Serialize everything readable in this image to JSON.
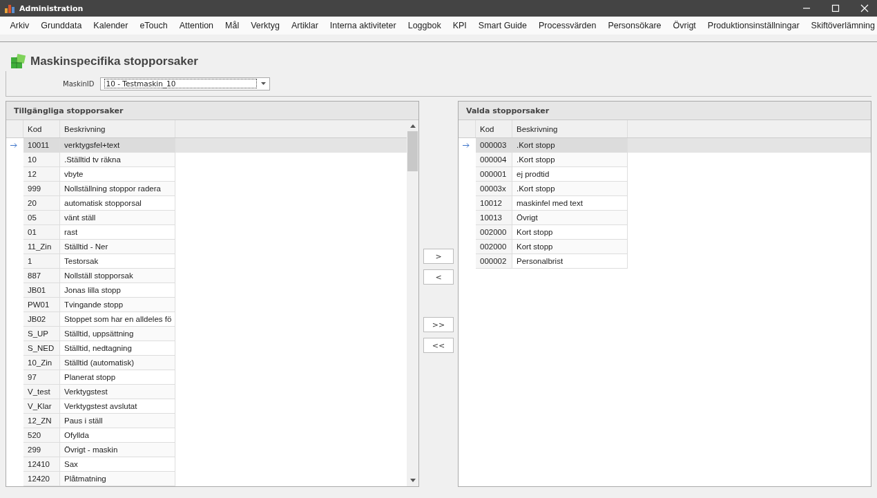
{
  "window": {
    "title": "Administration"
  },
  "menu": [
    {
      "label": "Arkiv"
    },
    {
      "label": "Grunddata"
    },
    {
      "label": "Kalender"
    },
    {
      "label": "eTouch"
    },
    {
      "label": "Attention"
    },
    {
      "label": "Mål"
    },
    {
      "label": "Verktyg"
    },
    {
      "label": "Artiklar"
    },
    {
      "label": "Interna aktiviteter"
    },
    {
      "label": "Loggbok"
    },
    {
      "label": "KPI"
    },
    {
      "label": "Smart Guide"
    },
    {
      "label": "Processvärden"
    },
    {
      "label": "Personsökare"
    },
    {
      "label": "Övrigt"
    },
    {
      "label": "Produktionsinställningar"
    },
    {
      "label": "Skiftöverlämning"
    }
  ],
  "page_title": "Maskinspecifika stopporsaker",
  "machine": {
    "label": "MaskinID",
    "value": "10 - Testmaskin_10"
  },
  "available": {
    "title": "Tillgängliga stopporsaker",
    "columns": [
      "Kod",
      "Beskrivning"
    ],
    "rows": [
      {
        "code": "10011",
        "description": "verktygsfel+text",
        "selected": true
      },
      {
        "code": "10",
        "description": ".Ställtid tv räkna",
        "selected": false
      },
      {
        "code": "12",
        "description": "vbyte",
        "selected": false
      },
      {
        "code": "999",
        "description": "Nollställning stoppor radera",
        "selected": false
      },
      {
        "code": "20",
        "description": "automatisk stopporsal",
        "selected": false
      },
      {
        "code": "05",
        "description": "vänt ställ",
        "selected": false
      },
      {
        "code": "01",
        "description": "rast",
        "selected": false
      },
      {
        "code": "11_Zin",
        "description": "Ställtid - Ner",
        "selected": false
      },
      {
        "code": "1",
        "description": "Testorsak",
        "selected": false
      },
      {
        "code": "887",
        "description": "Nollställ stopporsak",
        "selected": false
      },
      {
        "code": "JB01",
        "description": "Jonas lilla stopp",
        "selected": false
      },
      {
        "code": "PW01",
        "description": "Tvingande stopp",
        "selected": false
      },
      {
        "code": "JB02",
        "description": "Stoppet som har en alldeles fö",
        "selected": false
      },
      {
        "code": "S_UP",
        "description": "Ställtid, uppsättning",
        "selected": false
      },
      {
        "code": "S_NED",
        "description": "Ställtid, nedtagning",
        "selected": false
      },
      {
        "code": "10_Zin",
        "description": "Ställtid (automatisk)",
        "selected": false
      },
      {
        "code": "97",
        "description": "Planerat stopp",
        "selected": false
      },
      {
        "code": "V_test",
        "description": "Verktygstest",
        "selected": false
      },
      {
        "code": "V_Klar",
        "description": "Verktygstest avslutat",
        "selected": false
      },
      {
        "code": "12_ZN",
        "description": "Paus i ställ",
        "selected": false
      },
      {
        "code": "520",
        "description": "Ofyllda",
        "selected": false
      },
      {
        "code": "299",
        "description": "Övrigt - maskin",
        "selected": false
      },
      {
        "code": "12410",
        "description": "Sax",
        "selected": false
      },
      {
        "code": "12420",
        "description": "Plåtmatning",
        "selected": false
      }
    ]
  },
  "transfer_buttons": [
    ">",
    "<",
    ">>",
    "<<"
  ],
  "chosen": {
    "title": "Valda stopporsaker",
    "columns": [
      "Kod",
      "Beskrivning"
    ],
    "rows": [
      {
        "code": "000003",
        "description": ".Kort stopp",
        "selected": true
      },
      {
        "code": "000004",
        "description": ".Kort stopp",
        "selected": false
      },
      {
        "code": "000001",
        "description": "ej prodtid",
        "selected": false
      },
      {
        "code": "00003x",
        "description": ".Kort stopp",
        "selected": false
      },
      {
        "code": "10012",
        "description": "maskinfel med text",
        "selected": false
      },
      {
        "code": "10013",
        "description": "Övrigt",
        "selected": false
      },
      {
        "code": "002000",
        "description": "Kort stopp",
        "selected": false
      },
      {
        "code": "002000",
        "description": "Kort stopp",
        "selected": false
      },
      {
        "code": "000002",
        "description": "Personalbrist",
        "selected": false
      }
    ]
  }
}
